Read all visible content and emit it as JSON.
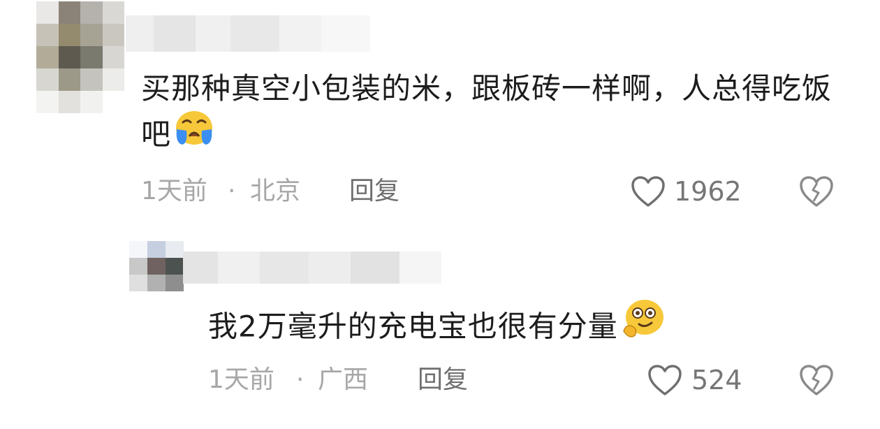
{
  "comments": [
    {
      "text": "买那种真空小包装的米，跟板砖一样啊，人总得吃饭吧",
      "emoji": "crying-face-emoji",
      "time": "1天前",
      "separator": "·",
      "location": "北京",
      "reply_label": "回复",
      "likes": "1962"
    }
  ],
  "replies": [
    {
      "text": "我2万毫升的充电宝也很有分量",
      "emoji": "thinking-dizzy-face-emoji",
      "time": "1天前",
      "separator": "·",
      "location": "广西",
      "reply_label": "回复",
      "likes": "524"
    }
  ],
  "icons": {
    "like": "heart-outline-icon",
    "dislike": "broken-heart-icon"
  },
  "colors": {
    "text": "#1c1c1c",
    "meta": "#a7a7a7",
    "reply_button": "#6f6f6f",
    "like_icon": "#6f6f6f",
    "dislike_icon": "#8a8a8a",
    "emoji_yellow": "#f7c83a",
    "emoji_tear_blue": "#3b8ff2"
  }
}
